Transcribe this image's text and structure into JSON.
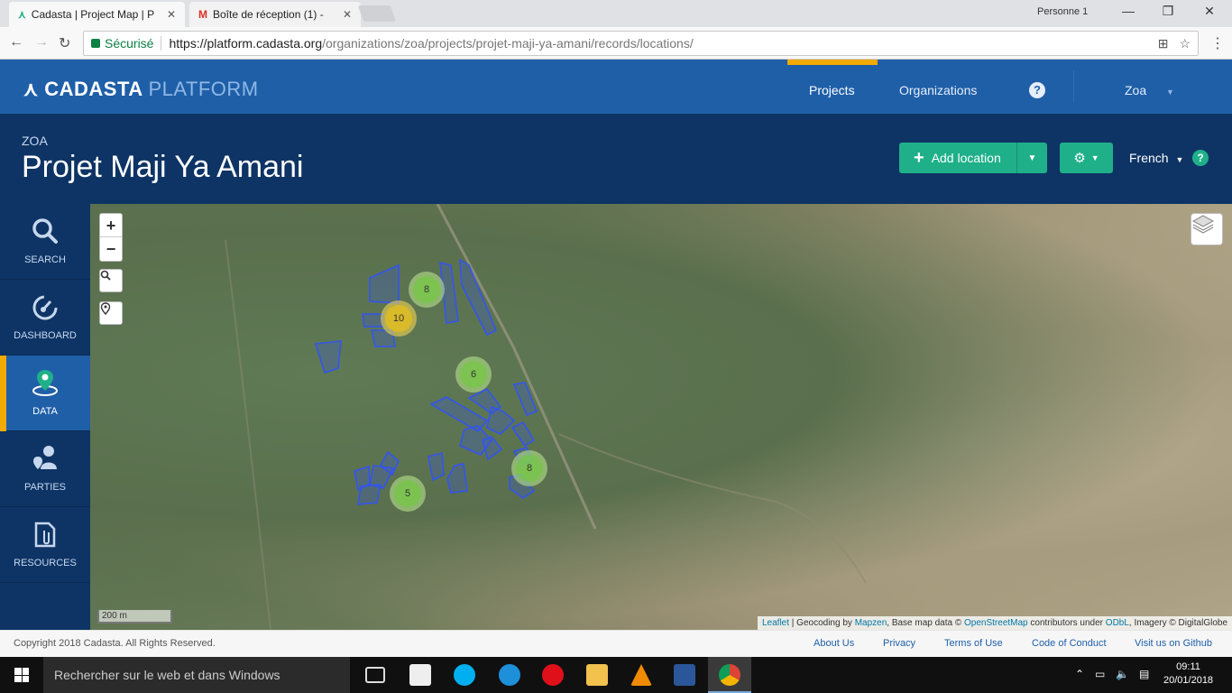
{
  "browser": {
    "tabs": [
      {
        "title": "Cadasta | Project Map | P"
      },
      {
        "title": "Boîte de réception (1) - "
      }
    ],
    "profile": "Personne 1",
    "secure_label": "Sécurisé",
    "url_host": "https://platform.cadasta.org",
    "url_path": "/organizations/zoa/projects/projet-maji-ya-amani/records/locations/"
  },
  "header": {
    "logo_main": "CADASTA",
    "logo_sub": "PLATFORM",
    "nav": {
      "projects": "Projects",
      "organizations": "Organizations",
      "help": "?",
      "user": "Zoa"
    }
  },
  "project": {
    "org": "ZOA",
    "title": "Projet Maji Ya Amani",
    "add_location": "Add location",
    "language": "French",
    "help": "?"
  },
  "sidebar": {
    "items": [
      {
        "label": "SEARCH",
        "icon": "search-icon"
      },
      {
        "label": "DASHBOARD",
        "icon": "dashboard-icon"
      },
      {
        "label": "DATA",
        "icon": "map-pin-icon"
      },
      {
        "label": "PARTIES",
        "icon": "parties-icon"
      },
      {
        "label": "RESOURCES",
        "icon": "resources-icon"
      }
    ],
    "active": "DATA"
  },
  "map": {
    "zoom_in": "+",
    "zoom_out": "−",
    "scale": "200 m",
    "clusters": [
      {
        "count": "8",
        "color": "green"
      },
      {
        "count": "10",
        "color": "yellow"
      },
      {
        "count": "6",
        "color": "green"
      },
      {
        "count": "8",
        "color": "green"
      },
      {
        "count": "5",
        "color": "green"
      }
    ],
    "attribution": {
      "leaflet": "Leaflet",
      "geocoding_prefix": " | Geocoding by ",
      "mapzen": "Mapzen",
      "basemap_prefix": ", Base map data © ",
      "osm": "OpenStreetMap",
      "contrib": " contributors under ",
      "odbl": "ODbL",
      "imagery": ", Imagery © DigitalGlobe"
    },
    "parcel_color": "#3355ee"
  },
  "footer": {
    "copyright": "Copyright 2018 Cadasta. All Rights Reserved.",
    "links": [
      "About Us",
      "Privacy",
      "Terms of Use",
      "Code of Conduct",
      "Visit us on Github"
    ]
  },
  "taskbar": {
    "search_placeholder": "Rechercher sur le web et dans Windows",
    "time": "09:11",
    "date": "20/01/2018"
  }
}
